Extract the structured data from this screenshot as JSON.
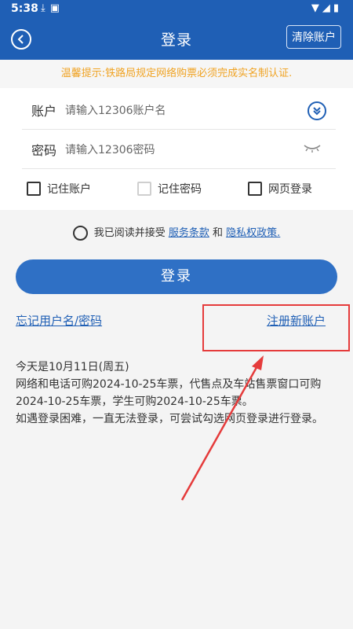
{
  "status_bar": {
    "time": "5:38",
    "left_icons": [
      "download-icon",
      "font-a-icon"
    ],
    "right_icons": [
      "wifi-icon",
      "signal-icon",
      "battery-icon"
    ]
  },
  "header": {
    "title": "登录",
    "back_icon": "chevron-left-circle-icon",
    "clear_account_label": "清除账户",
    "background_color": "#1f5fb5"
  },
  "notice": {
    "text": "温馨提示:铁路局规定网络购票必须完成实名制认证.",
    "color": "#f0a323"
  },
  "form": {
    "account": {
      "label": "账户",
      "placeholder": "请输入12306账户名",
      "dropdown_icon": "chevron-double-down-circle-icon"
    },
    "password": {
      "label": "密码",
      "placeholder": "请输入12306密码",
      "visibility_icon": "eye-closed-icon"
    },
    "options": [
      {
        "label": "记住账户",
        "checked": false,
        "enabled": true
      },
      {
        "label": "记住密码",
        "checked": false,
        "enabled": false
      },
      {
        "label": "网页登录",
        "checked": false,
        "enabled": true
      }
    ]
  },
  "agreement": {
    "prefix": "我已阅读并接受",
    "terms_link": "服务条款",
    "conjunction": "和",
    "privacy_link": "隐私权政策."
  },
  "login_button": {
    "label": "登录",
    "color": "#2f70c5"
  },
  "links": {
    "forgot": "忘记用户名/密码",
    "register": "注册新账户"
  },
  "info": {
    "line1": "今天是10月11日(周五)",
    "line2": "网络和电话可购2024-10-25车票，代售点及车站售票窗口可购2024-10-25车票，学生可购2024-10-25车票。",
    "line3": "如遇登录困难，一直无法登录，可尝试勾选网页登录进行登录。"
  },
  "annotation": {
    "color": "#e53b3b"
  }
}
